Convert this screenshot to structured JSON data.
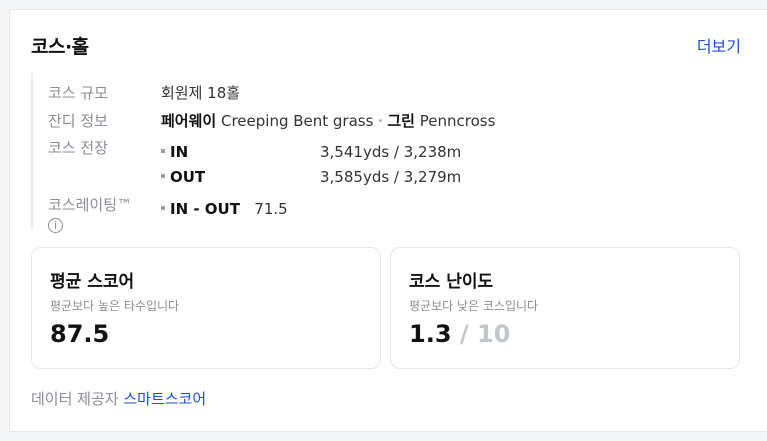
{
  "header": {
    "title": "코스·홀",
    "more_label": "더보기"
  },
  "info": {
    "size": {
      "label": "코스 규모",
      "value": "회원제 18홀"
    },
    "grass": {
      "label": "잔디 정보",
      "fairway_name": "페어웨이",
      "fairway_value": "Creeping Bent grass",
      "green_name": "그린",
      "green_value": "Penncross"
    },
    "length": {
      "label": "코스 전장",
      "rows": [
        {
          "key": "IN",
          "value": "3,541yds / 3,238m"
        },
        {
          "key": "OUT",
          "value": "3,585yds / 3,279m"
        }
      ]
    },
    "rating": {
      "label": "코스레이팅™",
      "info_icon": "ⓘ",
      "key": "IN - OUT",
      "value": "71.5"
    }
  },
  "stats": {
    "average": {
      "title": "평균 스코어",
      "desc": "평균보다 높은 타수입니다",
      "value": "87.5"
    },
    "difficulty": {
      "title": "코스 난이도",
      "desc": "평균보다 낮은 코스입니다",
      "value": "1.3",
      "max": "/ 10"
    }
  },
  "footer": {
    "prefix": "데이터 제공자",
    "provider": "스마트스코어"
  },
  "colors": {
    "link": "#1a4fd6",
    "muted": "#8a8d93"
  }
}
